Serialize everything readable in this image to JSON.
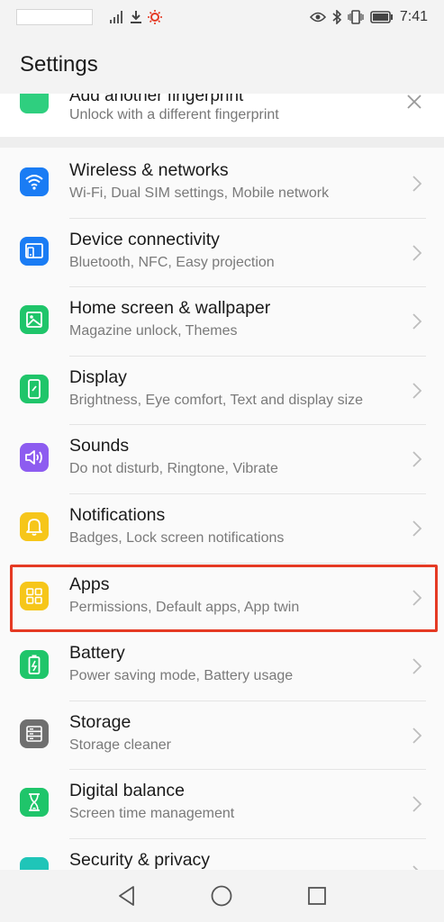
{
  "status_bar": {
    "time": "7:41",
    "icons_left": [
      "signal-icon",
      "download-icon",
      "sun-icon"
    ],
    "icons_right": [
      "eye-icon",
      "bluetooth-icon",
      "vibrate-icon",
      "battery-icon"
    ]
  },
  "header": {
    "title": "Settings"
  },
  "fingerprint_banner": {
    "title": "Add another fingerprint",
    "subtitle": "Unlock with a different fingerprint"
  },
  "items": [
    {
      "title": "Wireless & networks",
      "subtitle": "Wi-Fi, Dual SIM settings, Mobile network",
      "icon": "wifi-icon",
      "color": "#1a7cf4"
    },
    {
      "title": "Device connectivity",
      "subtitle": "Bluetooth, NFC, Easy projection",
      "icon": "device-connectivity-icon",
      "color": "#1a7cf4"
    },
    {
      "title": "Home screen & wallpaper",
      "subtitle": "Magazine unlock, Themes",
      "icon": "wallpaper-icon",
      "color": "#1fc56a"
    },
    {
      "title": "Display",
      "subtitle": "Brightness, Eye comfort, Text and display size",
      "icon": "display-icon",
      "color": "#1fc56a"
    },
    {
      "title": "Sounds",
      "subtitle": "Do not disturb, Ringtone, Vibrate",
      "icon": "speaker-icon",
      "color": "#8d5cf0"
    },
    {
      "title": "Notifications",
      "subtitle": "Badges, Lock screen notifications",
      "icon": "bell-icon",
      "color": "#f6c61a"
    },
    {
      "title": "Apps",
      "subtitle": "Permissions, Default apps, App twin",
      "icon": "apps-grid-icon",
      "color": "#f6c61a"
    },
    {
      "title": "Battery",
      "subtitle": "Power saving mode, Battery usage",
      "icon": "battery-icon",
      "color": "#1fc56a"
    },
    {
      "title": "Storage",
      "subtitle": "Storage cleaner",
      "icon": "storage-icon",
      "color": "#6f6f6f"
    },
    {
      "title": "Digital balance",
      "subtitle": "Screen time management",
      "icon": "hourglass-icon",
      "color": "#1fc56a"
    },
    {
      "title": "Security & privacy",
      "subtitle": "",
      "icon": "shield-icon",
      "color": "#1fc5b8"
    }
  ],
  "highlight_color": "#e53a24",
  "nav": [
    "back-icon",
    "home-icon",
    "recents-icon"
  ]
}
